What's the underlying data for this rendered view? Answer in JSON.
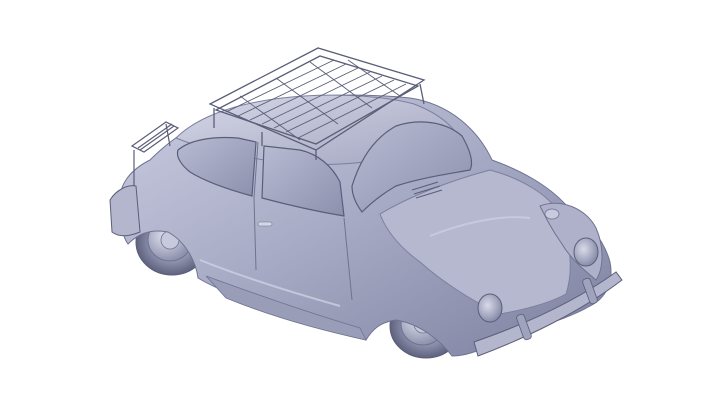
{
  "scene": {
    "background_color": "#ffffff",
    "model_color": "#a9acc6",
    "model_shadow_color": "#6f7391",
    "model_highlight_color": "#d4d6e6",
    "wire_color": "#5b5e78"
  },
  "objects": {
    "car": "vw-beetle-3d-model",
    "rack": "roof-rack",
    "carrier": "rear-luggage-carrier"
  }
}
